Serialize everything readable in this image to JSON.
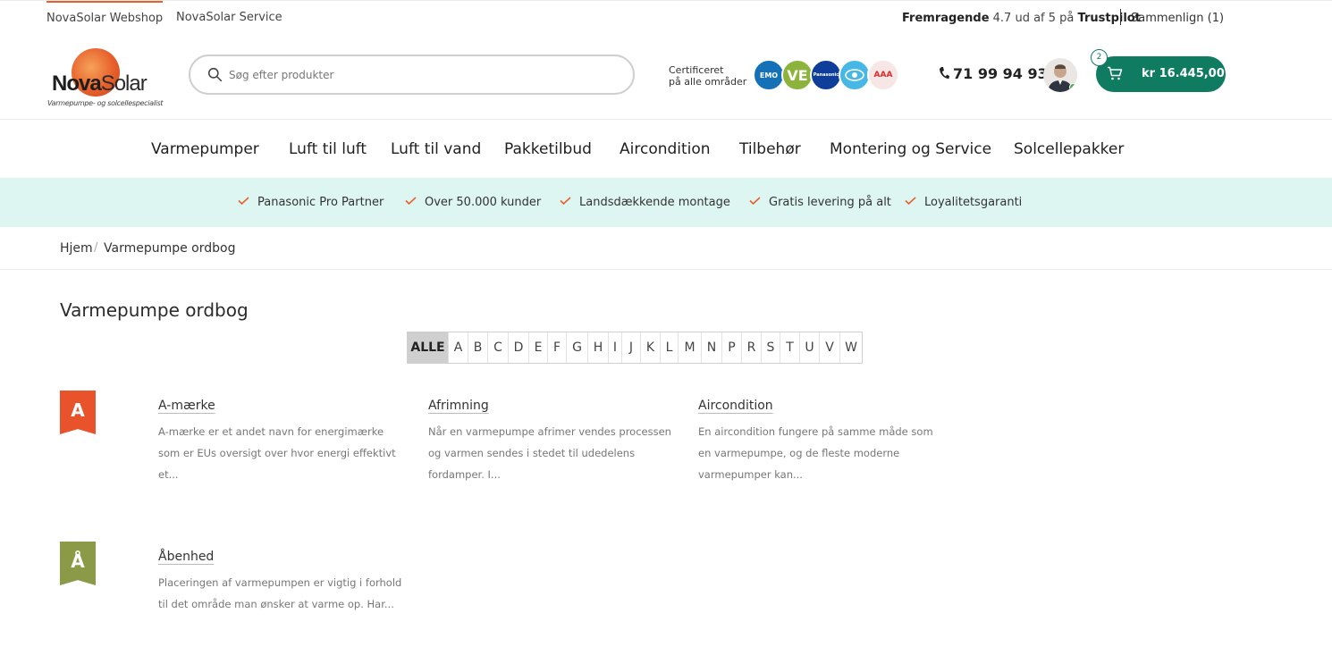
{
  "topbar": {
    "tabs": [
      "NovaSolar Webshop",
      "NovaSolar Service"
    ],
    "trustpilot": {
      "label": "Fremragende",
      "score": "4.7 ud af 5 på",
      "brand": "Trustpilot"
    },
    "compare": "Sammenlign (1)"
  },
  "header": {
    "logo": {
      "bold": "Nova",
      "light": "Solar",
      "tagline": "Varmepumpe- og solcellespecialist"
    },
    "search_placeholder": "Søg efter produkter",
    "cert_line1": "Certificeret",
    "cert_line2": "på alle områder",
    "badges": [
      "EMO",
      "VE",
      "Panasonic",
      "eye",
      "AAA"
    ],
    "phone": "71 99 94 93",
    "cart": {
      "count": "2",
      "price": "kr 16.445,00"
    }
  },
  "nav": [
    "Varmepumper",
    "Luft til luft",
    "Luft til vand",
    "Pakketilbud",
    "Aircondition",
    "Tilbehør",
    "Montering og Service",
    "Solcellepakker"
  ],
  "usps": [
    "Panasonic Pro Partner",
    "Over 50.000 kunder",
    "Landsdækkende montage",
    "Gratis levering på alt",
    "Loyalitetsgaranti"
  ],
  "breadcrumb": [
    "Hjem",
    "Varmepumpe ordbog"
  ],
  "page_title": "Varmepumpe ordbog",
  "alphabet": [
    "ALLE",
    "A",
    "B",
    "C",
    "D",
    "E",
    "F",
    "G",
    "H",
    "I",
    "J",
    "K",
    "L",
    "M",
    "N",
    "P",
    "R",
    "S",
    "T",
    "U",
    "V",
    "W"
  ],
  "glossary": [
    {
      "letter": "A",
      "color": "#e8532b",
      "entries": [
        {
          "term": "A-mærke",
          "desc": "A-mærke er et andet navn for energimærke som er EUs oversigt over hvor energi effektivt et..."
        },
        {
          "term": "Afrimning",
          "desc": "Når en varmepumpe afrimer vendes processen og varmen sendes i stedet til udedelens fordamper. I..."
        },
        {
          "term": "Aircondition",
          "desc": "En aircondition fungere på samme måde som en varmepumpe, og de fleste moderne varmepumper kan..."
        }
      ]
    },
    {
      "letter": "Å",
      "color": "#8a9a46",
      "entries": [
        {
          "term": "Åbenhed",
          "desc": "Placeringen af varmepumpen er vigtig i forhold til det område man ønsker at varme op. Har..."
        }
      ]
    }
  ],
  "colors": {
    "accent": "#e8602c",
    "cart": "#0f7b60",
    "usp_bg": "#ddf6f1"
  }
}
